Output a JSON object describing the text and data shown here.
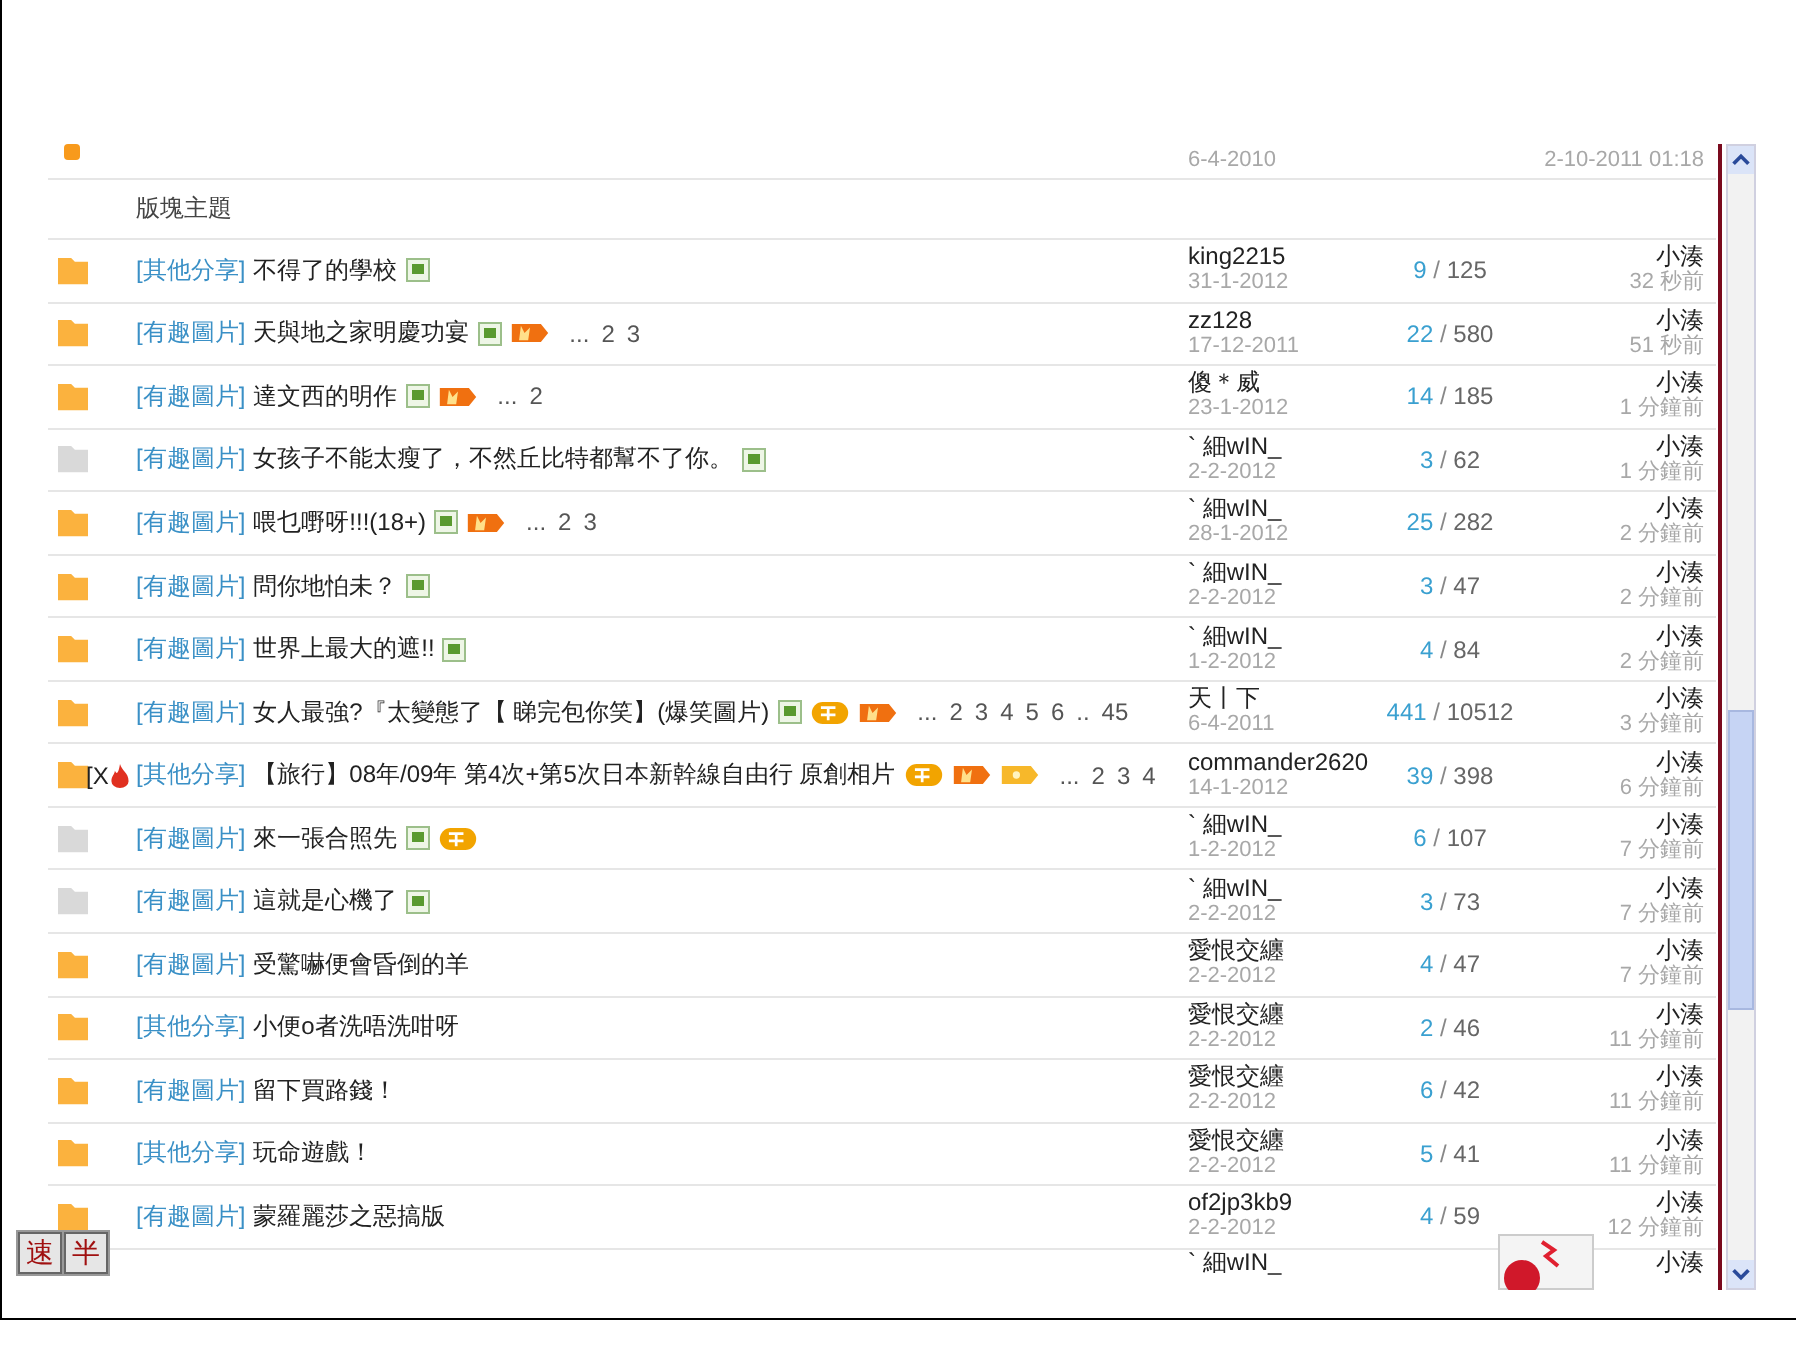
{
  "pinned_row": {
    "started": "6-4-2010",
    "last_post": "2-10-2011 01:18"
  },
  "section_heading": "版塊主題",
  "rows": [
    {
      "new": true,
      "prefix": "[其他分享]",
      "title": "不得了的學校",
      "badges": [
        {
          "kind": "image"
        }
      ],
      "pages": [],
      "author": "king2215",
      "date": "31-1-2012",
      "replies": "9",
      "sep": "/",
      "views": "125",
      "last_poster": "小湊",
      "last_time": "32 秒前"
    },
    {
      "new": true,
      "prefix": "[有趣圖片]",
      "title": "天與地之家明慶功宴",
      "badges": [
        {
          "kind": "image"
        },
        {
          "kind": "hot"
        }
      ],
      "pages": [
        "...",
        "2",
        "3"
      ],
      "author": "zz128",
      "date": "17-12-2011",
      "replies": "22",
      "sep": "/",
      "views": "580",
      "last_poster": "小湊",
      "last_time": "51 秒前"
    },
    {
      "new": true,
      "prefix": "[有趣圖片]",
      "title": "達文西的明作",
      "badges": [
        {
          "kind": "image"
        },
        {
          "kind": "hot"
        }
      ],
      "pages": [
        "...",
        "2"
      ],
      "author": "傻＊威",
      "date": "23-1-2012",
      "replies": "14",
      "sep": "/",
      "views": "185",
      "last_poster": "小湊",
      "last_time": "1 分鐘前"
    },
    {
      "new": false,
      "prefix": "[有趣圖片]",
      "title": "女孩子不能太瘦了，不然丘比特都幫不了你。",
      "badges": [
        {
          "kind": "image"
        }
      ],
      "pages": [],
      "author": "` 細wIN_",
      "date": "2-2-2012",
      "replies": "3",
      "sep": "/",
      "views": "62",
      "last_poster": "小湊",
      "last_time": "1 分鐘前"
    },
    {
      "new": true,
      "prefix": "[有趣圖片]",
      "title": "喂乜嘢呀!!!(18+)",
      "badges": [
        {
          "kind": "image"
        },
        {
          "kind": "hot"
        }
      ],
      "pages": [
        "...",
        "2",
        "3"
      ],
      "author": "` 細wIN_",
      "date": "28-1-2012",
      "replies": "25",
      "sep": "/",
      "views": "282",
      "last_poster": "小湊",
      "last_time": "2 分鐘前"
    },
    {
      "new": true,
      "prefix": "[有趣圖片]",
      "title": "問你地怕未？",
      "badges": [
        {
          "kind": "image"
        }
      ],
      "pages": [],
      "author": "` 細wIN_",
      "date": "2-2-2012",
      "replies": "3",
      "sep": "/",
      "views": "47",
      "last_poster": "小湊",
      "last_time": "2 分鐘前"
    },
    {
      "new": true,
      "prefix": "[有趣圖片]",
      "title": "世界上最大的遮!!",
      "badges": [
        {
          "kind": "image"
        }
      ],
      "pages": [],
      "author": "` 細wIN_",
      "date": "1-2-2012",
      "replies": "4",
      "sep": "/",
      "views": "84",
      "last_poster": "小湊",
      "last_time": "2 分鐘前"
    },
    {
      "new": true,
      "prefix": "[有趣圖片]",
      "title": "女人最強?『太變態了【 睇完包你笑】(爆笑圖片)",
      "badges": [
        {
          "kind": "image"
        },
        {
          "kind": "recommend"
        },
        {
          "kind": "hot"
        }
      ],
      "pages": [
        "...",
        "2",
        "3",
        "4",
        "5",
        "6",
        "..",
        "45"
      ],
      "author": "天丨下",
      "date": "6-4-2011",
      "replies": "441",
      "sep": "/",
      "views": "10512",
      "last_poster": "小湊",
      "last_time": "3 分鐘前"
    },
    {
      "new": true,
      "marker": "[X",
      "prefix": "[其他分享]",
      "title": "【旅行】08年/09年 第4次+第5次日本新幹線自由行 原創相片",
      "badges": [
        {
          "kind": "recommend"
        },
        {
          "kind": "hot"
        },
        {
          "kind": "rating"
        }
      ],
      "pages": [
        "...",
        "2",
        "3",
        "4"
      ],
      "author": "commander2620",
      "date": "14-1-2012",
      "replies": "39",
      "sep": "/",
      "views": "398",
      "last_poster": "小湊",
      "last_time": "6 分鐘前"
    },
    {
      "new": false,
      "prefix": "[有趣圖片]",
      "title": "來一張合照先",
      "badges": [
        {
          "kind": "image"
        },
        {
          "kind": "recommend"
        }
      ],
      "pages": [],
      "author": "` 細wIN_",
      "date": "1-2-2012",
      "replies": "6",
      "sep": "/",
      "views": "107",
      "last_poster": "小湊",
      "last_time": "7 分鐘前"
    },
    {
      "new": false,
      "prefix": "[有趣圖片]",
      "title": "這就是心機了",
      "badges": [
        {
          "kind": "image"
        }
      ],
      "pages": [],
      "author": "` 細wIN_",
      "date": "2-2-2012",
      "replies": "3",
      "sep": "/",
      "views": "73",
      "last_poster": "小湊",
      "last_time": "7 分鐘前"
    },
    {
      "new": true,
      "prefix": "[有趣圖片]",
      "title": "受驚嚇便會昏倒的羊",
      "badges": [],
      "pages": [],
      "author": "愛恨交纏",
      "date": "2-2-2012",
      "replies": "4",
      "sep": "/",
      "views": "47",
      "last_poster": "小湊",
      "last_time": "7 分鐘前"
    },
    {
      "new": true,
      "prefix": "[其他分享]",
      "title": "小便o者洗唔洗咁呀",
      "badges": [],
      "pages": [],
      "author": "愛恨交纏",
      "date": "2-2-2012",
      "replies": "2",
      "sep": "/",
      "views": "46",
      "last_poster": "小湊",
      "last_time": "11 分鐘前"
    },
    {
      "new": true,
      "prefix": "[有趣圖片]",
      "title": "留下買路錢！",
      "badges": [],
      "pages": [],
      "author": "愛恨交纏",
      "date": "2-2-2012",
      "replies": "6",
      "sep": "/",
      "views": "42",
      "last_poster": "小湊",
      "last_time": "11 分鐘前"
    },
    {
      "new": true,
      "prefix": "[其他分享]",
      "title": "玩命遊戲！",
      "badges": [],
      "pages": [],
      "author": "愛恨交纏",
      "date": "2-2-2012",
      "replies": "5",
      "sep": "/",
      "views": "41",
      "last_poster": "小湊",
      "last_time": "11 分鐘前"
    },
    {
      "new": true,
      "prefix": "[有趣圖片]",
      "title": "蒙羅麗莎之惡搞版",
      "badges": [],
      "pages": [],
      "author": "of2jp3kb9",
      "date": "2-2-2012",
      "replies": "4",
      "sep": "/",
      "views": "59",
      "last_poster": "小湊",
      "last_time": "12 分鐘前"
    }
  ],
  "partial_row": {
    "author": "` 細wIN_",
    "last_poster": "小湊"
  },
  "ime_toolbar": [
    "速",
    "半"
  ]
}
